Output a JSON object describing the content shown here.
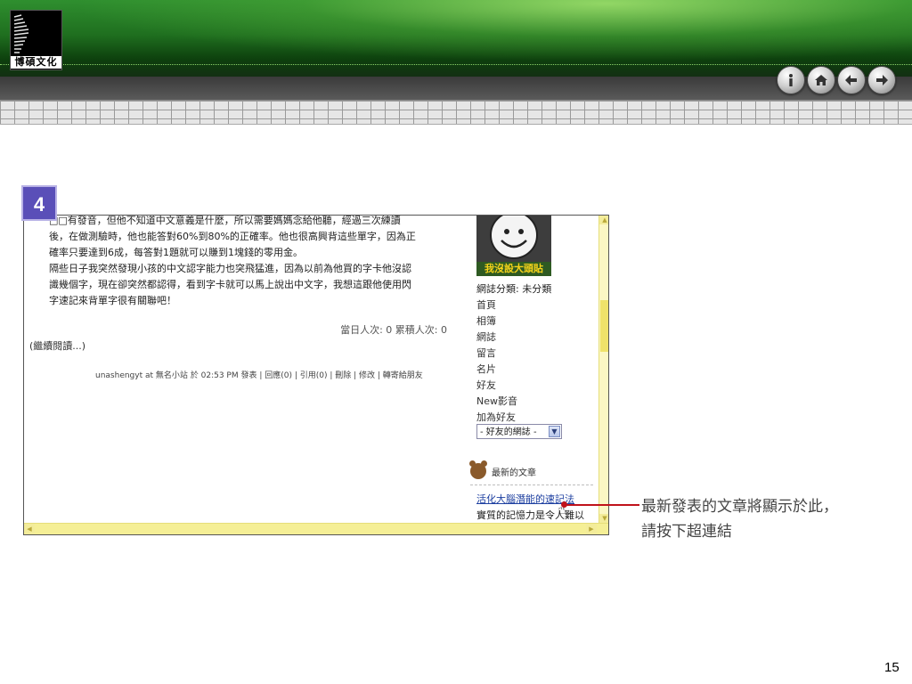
{
  "header": {
    "logo_text": "博碩文化",
    "nav_icons": [
      "info-icon",
      "home-icon",
      "back-arrow-icon",
      "forward-arrow-icon"
    ]
  },
  "step": {
    "number": "4"
  },
  "blog": {
    "paragraph_lines": [
      "□□有發音，但他不知道中文意義是什麼，所以需要媽媽念給他聽，經過三次練讀",
      "後，在做測驗時，他也能答對60%到80%的正確率。他也很高興背這些單字，因為正",
      "確率只要達到6成，每答對1題就可以賺到1塊錢的零用金。",
      "隔些日子我突然發現小孩的中文認字能力也突飛猛進，因為以前為他買的字卡他沒認",
      "識幾個字，現在卻突然都認得，看到字卡就可以馬上說出中文字，我想這跟他使用閃",
      "字速記來背單字很有關聯吧！"
    ],
    "visits": "當日人次: 0 累積人次: 0",
    "continue": "(繼續閱讀...)",
    "meta": "unashengyt at 無名小站 於 02:53 PM 發表 | 回應(0) | 引用(0) | 刪除 | 修改 | 轉寄給朋友"
  },
  "sidebar": {
    "avatar_caption": "我沒設大頭貼",
    "category": "網誌分類: 未分類",
    "links": [
      "首頁",
      "相簿",
      "網誌",
      "留言",
      "名片",
      "好友",
      "New影音",
      "加為好友"
    ],
    "friends_select": "- 好友的網誌 -",
    "latest_heading": "最新的文章",
    "latest_link": "活化大腦潛能的速記法",
    "latest_next": "實質的記憶力是令人難以"
  },
  "callout": {
    "line1": "最新發表的文章將顯示於此，",
    "line2": "請按下超連結"
  },
  "page_number": "15"
}
